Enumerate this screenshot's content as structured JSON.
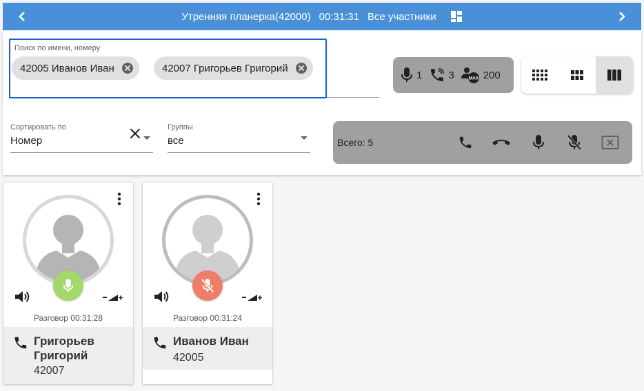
{
  "header": {
    "title": "Утренняя планерка(42000)",
    "timer": "00:31:31",
    "participants_label": "Все участники",
    "bg_color": "#4a90d9"
  },
  "search": {
    "label": "Поиск по имени, номеру",
    "placeholder": "",
    "chips": [
      {
        "label": "42005 Иванов Иван"
      },
      {
        "label": "42007 Григорьев Григорий"
      }
    ]
  },
  "stats": {
    "speakers": "1",
    "calls": "3",
    "max": "200",
    "max_badge": "MAX"
  },
  "view_modes": [
    "grid-small",
    "grid-medium",
    "columns"
  ],
  "sort": {
    "label": "Сортировать по",
    "value": "Номер"
  },
  "groups": {
    "label": "Группы",
    "value": "все"
  },
  "actions": {
    "total_label": "Всего: 5"
  },
  "participants": [
    {
      "name": "Григорьев Григорий",
      "number": "42007",
      "status": "Разговор 00:31:28",
      "mic": "on",
      "mic_color": "#a5d86b"
    },
    {
      "name": "Иванов Иван",
      "number": "42005",
      "status": "Разговор 00:31:24",
      "mic": "off",
      "mic_color": "#ef7e68"
    }
  ]
}
